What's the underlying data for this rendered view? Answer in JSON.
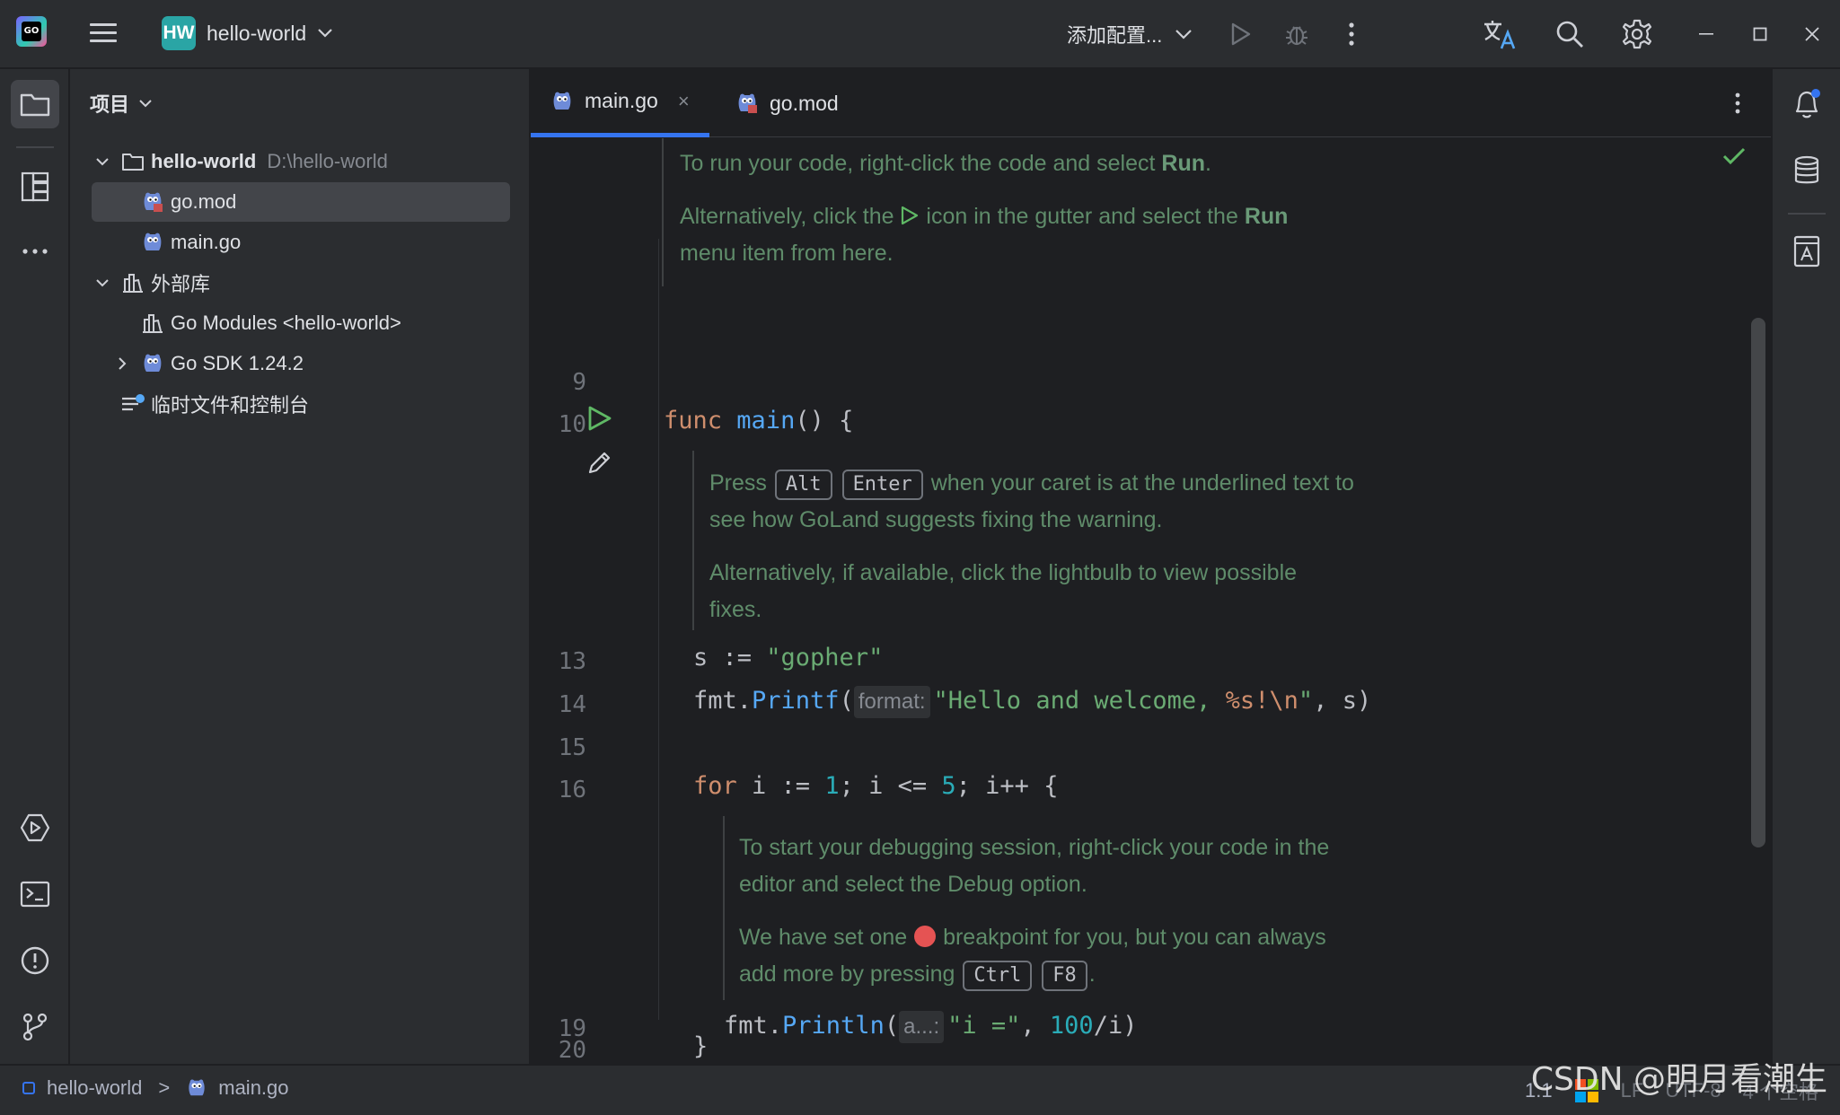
{
  "titlebar": {
    "project_badge": "HW",
    "project_name": "hello-world",
    "run_config": "添加配置..."
  },
  "project_panel": {
    "title": "项目",
    "tree": [
      {
        "label": "hello-world",
        "hint": "D:\\hello-world"
      },
      {
        "label": "go.mod"
      },
      {
        "label": "main.go"
      },
      {
        "label": "外部库"
      },
      {
        "label": "Go Modules <hello-world>"
      },
      {
        "label": "Go SDK 1.24.2"
      },
      {
        "label": "临时文件和控制台"
      }
    ]
  },
  "editor": {
    "tabs": [
      {
        "label": "main.go",
        "close": "×"
      },
      {
        "label": "go.mod"
      }
    ],
    "doc1": {
      "line1_pre": "To run your code, right-click the code and select ",
      "line1_bold": "Run",
      "line1_post": ".",
      "line2_pre": "Alternatively, click the ",
      "line2_mid": " icon in the gutter and select the ",
      "line2_bold": "Run",
      "line3": "menu item from here."
    },
    "doc2": {
      "press": "Press",
      "key1": "Alt",
      "key2": "Enter",
      "line1_post": "when your caret is at the underlined text to",
      "line2": "see how GoLand suggests fixing the warning.",
      "line3": "Alternatively, if available, click the lightbulb to view possible",
      "line4": "fixes."
    },
    "doc3": {
      "line1": "To start your debugging session, right-click your code in the",
      "line2": "editor and select the Debug option.",
      "line3_pre": "We have set one",
      "line3_post": "breakpoint for you, but you can always",
      "line4_pre": "add more by pressing",
      "key1": "Ctrl",
      "key2": "F8",
      "line4_post": "."
    },
    "line_numbers": [
      "9",
      "10",
      "13",
      "14",
      "15",
      "16",
      "19",
      "20"
    ],
    "code": {
      "l10_kw": "func",
      "l10_fn": "main",
      "l10_rest": "() {",
      "l13_var": "s := ",
      "l13_str": "\"gopher\"",
      "l14_pre": "fmt.",
      "l14_fn": "Printf",
      "l14_paren": "(",
      "l14_hint": "format:",
      "l14_str1": "\"Hello and welcome, ",
      "l14_fmt": "%s!\\n",
      "l14_str2": "\"",
      "l14_rest": ", s)",
      "l16_kw": "for",
      "l16_a": " i := ",
      "l16_n1": "1",
      "l16_b": "; i <= ",
      "l16_n2": "5",
      "l16_c": "; i++ {",
      "l19_pre": "fmt.",
      "l19_fn": "Println",
      "l19_paren": "(",
      "l19_hint": "a...:",
      "l19_str": "\"i =\"",
      "l19_comma": ", ",
      "l19_num": "100",
      "l19_rest": "/i)",
      "l20": "}"
    }
  },
  "statusbar": {
    "crumb_project": "hello-world",
    "crumb_sep": ">",
    "crumb_file": "main.go",
    "position": "1:1",
    "line_sep": "LF",
    "encoding": "UTF-8",
    "indent": "4 个空格",
    "watermark": "CSDN @明月看潮生"
  },
  "colors": {
    "accent": "#3574f0",
    "doc_text": "#5f8c6a",
    "keyword": "#cf8e6d",
    "function": "#56a8f5",
    "string": "#6aab73",
    "number": "#2aacb8",
    "breakpoint": "#e55353"
  },
  "icons": [
    "goland-logo",
    "hamburger-menu-icon",
    "chevron-down-icon",
    "run-icon",
    "debug-icon",
    "more-vertical-icon",
    "translate-icon",
    "search-icon",
    "gear-icon",
    "minimize-icon",
    "maximize-icon",
    "close-icon",
    "folder-icon",
    "structure-icon",
    "more-horizontal-icon",
    "services-icon",
    "terminal-icon",
    "problems-icon",
    "git-icon",
    "bell-icon",
    "database-icon",
    "ai-assistant-icon",
    "gopher-icon",
    "library-icon",
    "scratches-icon",
    "checkmark-icon",
    "pencil-icon",
    "windows-logo"
  ]
}
